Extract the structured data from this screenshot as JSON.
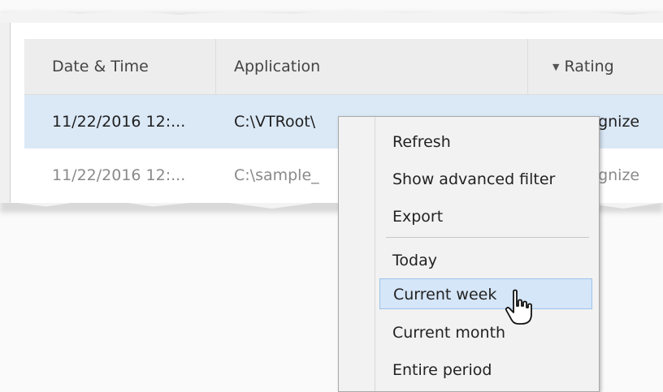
{
  "table": {
    "columns": [
      {
        "label": "Date & Time"
      },
      {
        "label": "Application"
      },
      {
        "label": "Rating",
        "sort_indicator": "▼"
      }
    ],
    "rows": [
      {
        "datetime": "11/22/2016 12:...",
        "application": "C:\\VTRoot\\",
        "rating": "cognize"
      },
      {
        "datetime": "11/22/2016 12:...",
        "application": "C:\\sample_",
        "rating": "cognize"
      }
    ]
  },
  "context_menu": {
    "items": [
      {
        "label": "Refresh"
      },
      {
        "label": "Show advanced filter"
      },
      {
        "label": "Export"
      },
      {
        "label": "Today"
      },
      {
        "label": "Current week",
        "highlighted": true
      },
      {
        "label": "Current month"
      },
      {
        "label": "Entire period"
      }
    ]
  },
  "colors": {
    "selected_row": "#dbe9f7",
    "menu_highlight": "#d5e6f8",
    "menu_highlight_border": "#9cc3ec",
    "header_bg": "#ededed"
  },
  "icons": {
    "cursor": "hand-pointer-icon",
    "sort": "sort-descending-icon"
  }
}
